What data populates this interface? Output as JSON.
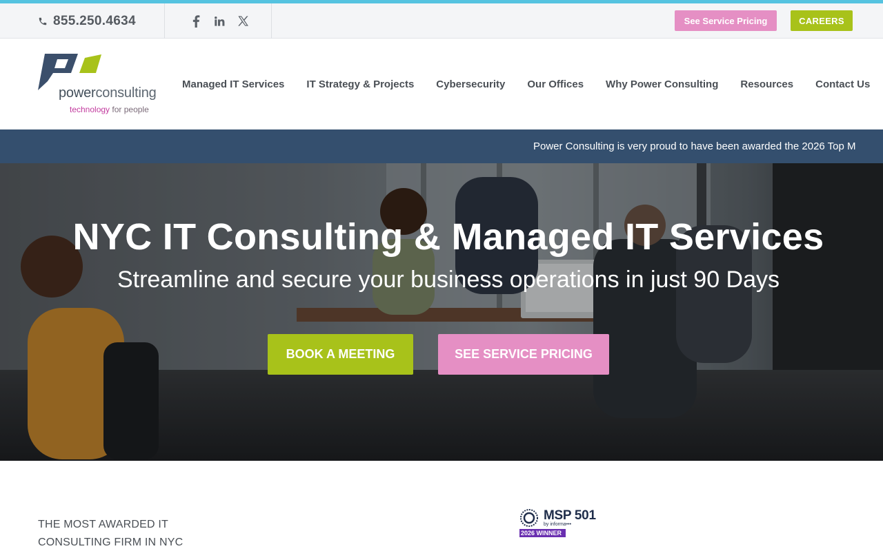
{
  "utility_bar": {
    "phone": "855.250.4634",
    "socials": [
      {
        "name": "facebook",
        "label": "f"
      },
      {
        "name": "linkedin",
        "label": "in"
      },
      {
        "name": "x",
        "label": "𝕏"
      }
    ],
    "see_pricing_label": "See Service Pricing",
    "careers_label": "CAREERS"
  },
  "logo": {
    "word_regular": "power",
    "word_light": "consulting",
    "tag_pink": "technology",
    "tag_rest": " for people"
  },
  "nav": {
    "items": [
      "Managed IT Services",
      "IT Strategy & Projects",
      "Cybersecurity",
      "Our Offices",
      "Why Power Consulting",
      "Resources",
      "Contact Us"
    ]
  },
  "ticker": {
    "text": "Power Consulting is very proud to have been awarded the 2026 Top M"
  },
  "hero": {
    "title": "NYC IT Consulting & Managed IT Services",
    "subtitle": "Streamline and secure your business operations in just 90 Days",
    "book_label": "BOOK A MEETING",
    "pricing_label": "SEE SERVICE PRICING"
  },
  "content": {
    "awarded_line1": "THE MOST AWARDED IT",
    "awarded_line2": "CONSULTING FIRM IN NYC",
    "msp_title": "MSP 501",
    "msp_by": "by informa•••",
    "msp_winner": "2026 WINNER"
  },
  "colors": {
    "accent_cyan": "#55c3e0",
    "brand_green": "#a8c21a",
    "brand_pink": "#e58fc4",
    "ticker_navy": "#344f6e"
  }
}
